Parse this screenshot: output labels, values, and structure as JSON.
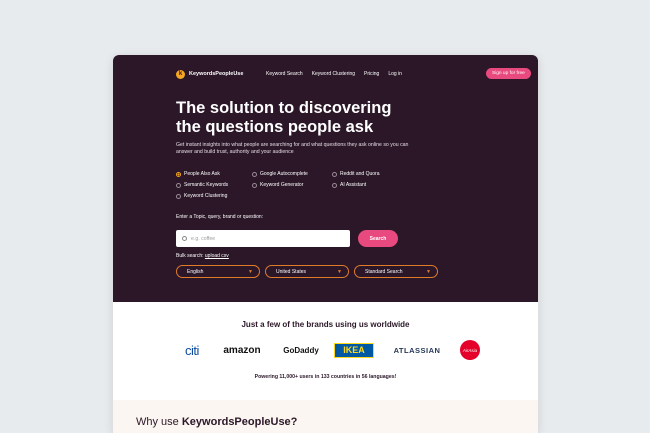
{
  "nav": {
    "logo_text": "KeywordsPeopleUse",
    "logo_mark": "k",
    "links": [
      "Keyword Search",
      "Keyword Clustering",
      "Pricing",
      "Log in"
    ],
    "signup_label": "Sign up for free"
  },
  "hero": {
    "headline_line1": "The solution to discovering",
    "headline_line2": "the questions people ask",
    "subtitle": "Get instant insights into what people are searching for and what questions they ask online so you can answer and build trust, authority and your audience",
    "options": [
      {
        "label": "People Also Ask",
        "selected": true
      },
      {
        "label": "Google Autocomplete",
        "selected": false
      },
      {
        "label": "Reddit and Quora",
        "selected": false
      },
      {
        "label": "Semantic Keywords",
        "selected": false
      },
      {
        "label": "Keyword Generator",
        "selected": false
      },
      {
        "label": "AI Assistant",
        "selected": false
      },
      {
        "label": "Keyword Clustering",
        "selected": false
      }
    ],
    "prompt": "Enter a Topic, query, brand or question:",
    "search_placeholder": "e.g. coffee",
    "search_button": "Search",
    "bulk_prefix": "Bulk search:",
    "bulk_link": "upload csv",
    "selects": [
      "English",
      "United States",
      "Standard Search"
    ]
  },
  "brands": {
    "title": "Just a few of the brands using us worldwide",
    "logos": [
      "citi",
      "amazon",
      "GoDaddy",
      "IKEA",
      "ATLASSIAN",
      "AirAsia"
    ],
    "powering": "Powering 11,000+ users in 133 countries in 56 languages!"
  },
  "why": {
    "prefix": "Why use",
    "brand": "KeywordsPeopleUse?"
  },
  "colors": {
    "hero_bg": "#2b1728",
    "accent_pink": "#e84a7f",
    "accent_orange": "#f5a623"
  }
}
